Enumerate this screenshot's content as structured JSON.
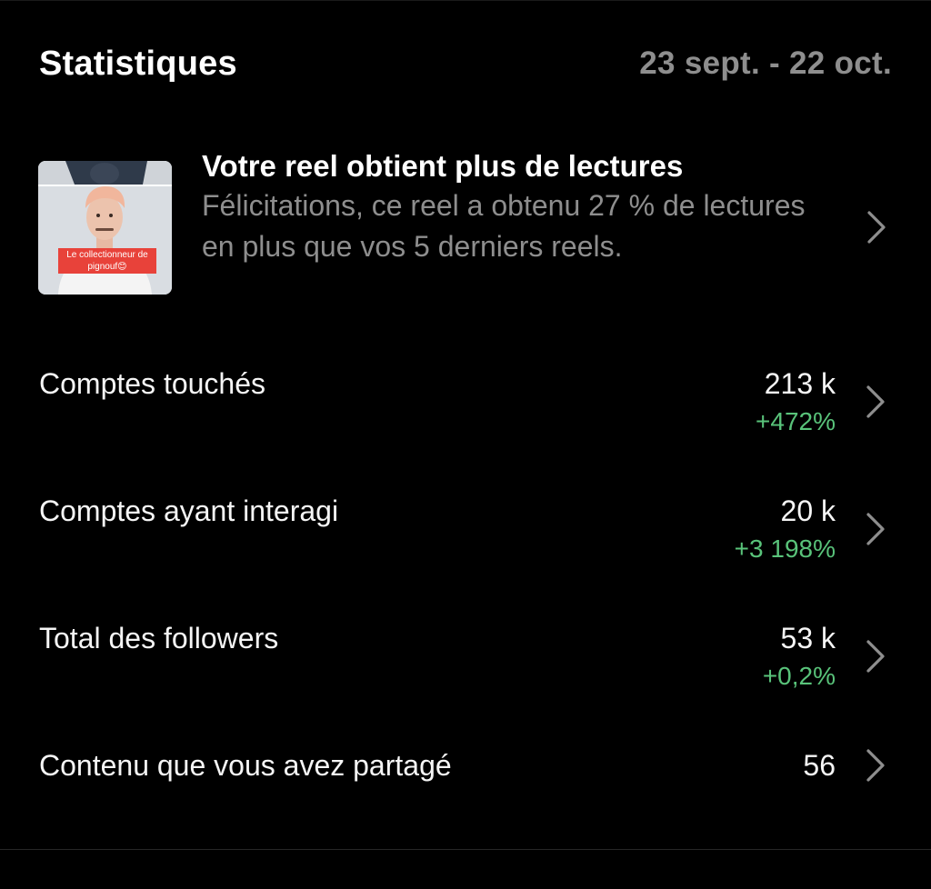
{
  "header": {
    "title": "Statistiques",
    "date_range": "23 sept. - 22 oct."
  },
  "insight": {
    "title": "Votre reel obtient plus de lectures",
    "body": "Félicitations, ce reel a obtenu 27 % de lectures en plus que vos 5 derniers reels.",
    "thumbnail_caption": "Le collectionneur de pignouf😊",
    "chevron_icon": "chevron-right-icon"
  },
  "metrics": [
    {
      "label": "Comptes touchés",
      "value": "213 k",
      "delta": "+472%"
    },
    {
      "label": "Comptes ayant interagi",
      "value": "20 k",
      "delta": "+3 198%"
    },
    {
      "label": "Total des followers",
      "value": "53 k",
      "delta": "+0,2%"
    },
    {
      "label": "Contenu que vous avez partagé",
      "value": "56"
    }
  ],
  "colors": {
    "background": "#000000",
    "primary_text": "#f5f5f5",
    "secondary_text": "#8e8e8e",
    "positive_delta": "#59c37a",
    "chevron": "#8e8e8e",
    "caption_bg": "#e8423a"
  }
}
